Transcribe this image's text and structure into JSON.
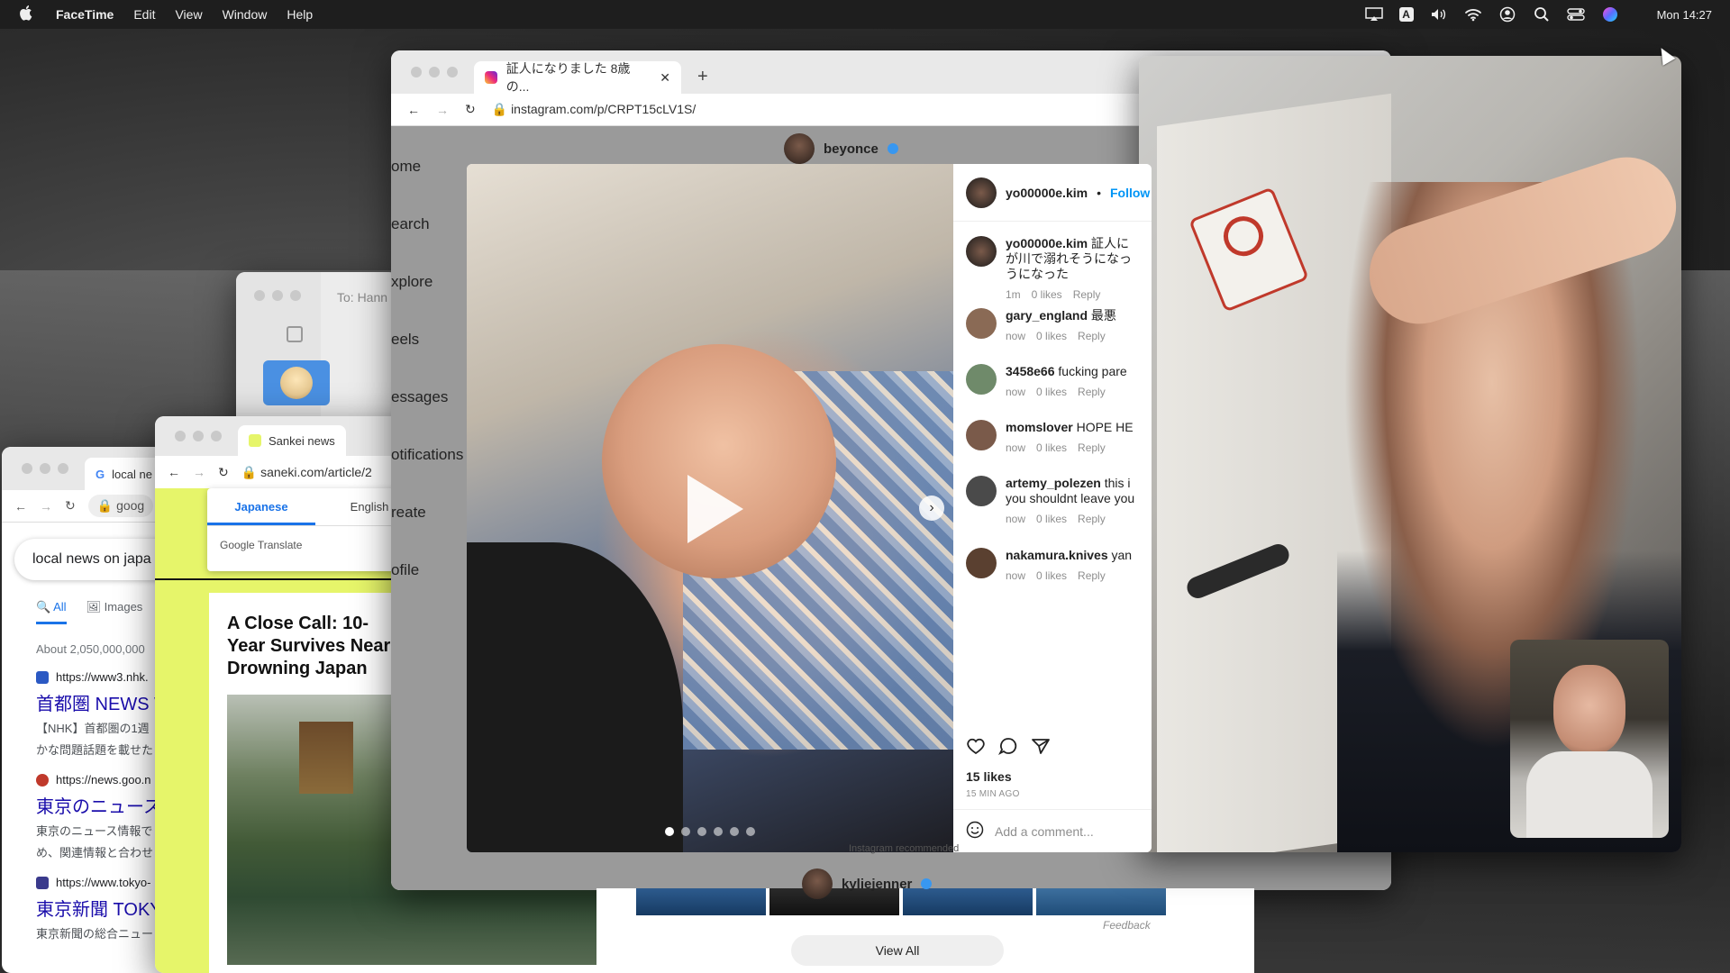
{
  "menubar": {
    "app": "FaceTime",
    "items": [
      "Edit",
      "View",
      "Window",
      "Help"
    ],
    "clock": "Mon 14:27",
    "icons": [
      "airplay-icon",
      "input-source-icon",
      "volume-icon",
      "wifi-icon",
      "user-icon",
      "spotlight-icon",
      "control-center-icon",
      "siri-icon"
    ],
    "input_source": "A"
  },
  "google": {
    "tab": "local ne",
    "address": "goog",
    "search_query": "local news on japa",
    "tabs": [
      "All",
      "Images"
    ],
    "count": "About 2,050,000,000",
    "results": [
      {
        "url": "https://www3.nhk.",
        "title": "首都圏 NEWS W",
        "snippet1": "【NHK】首都圏の1週",
        "snippet2": "かな問題話題を載せた",
        "fav_color": "#2b59c3"
      },
      {
        "url": "https://news.goo.n",
        "title": "東京のニュース",
        "snippet1": "東京のニュース情報で",
        "snippet2": "め、関連情報と合わせ",
        "fav_color": "#c0392b"
      },
      {
        "url": "https://www.tokyo-",
        "title": "東京新聞 TOKY",
        "snippet1": "東京新聞の総合ニュー",
        "snippet2": "",
        "fav_color": "#3a3a8c"
      }
    ]
  },
  "mail": {
    "to": "To: Hann"
  },
  "sankei": {
    "tab": "Sankei news",
    "address": "saneki.com/article/2",
    "translate": {
      "japanese": "Japanese",
      "english": "English",
      "brand": "Google Translate"
    },
    "headline": "A Close Call: 10-Year Survives Near-Drowning Japan"
  },
  "instagram": {
    "tab": "証人になりました 8歳の...",
    "address": "instagram.com/p/CRPT15cLV1S/",
    "nav": [
      "ome",
      "earch",
      "xplore",
      "eels",
      "essages",
      "otifications",
      "reate",
      "ofile"
    ],
    "feed_top_user": "beyonce",
    "post": {
      "user": "yo00000e.kim",
      "follow": "Follow",
      "caption_user": "yo00000e.kim",
      "caption_lines": [
        "証人に",
        "が川で溺れそうになっ",
        "うになった"
      ],
      "caption_meta": [
        "1m",
        "0 likes",
        "Reply"
      ],
      "comments": [
        {
          "user": "gary_england",
          "text": "最悪",
          "time": "now",
          "likes": "0 likes",
          "reply": "Reply",
          "avatar": "#8a6a55"
        },
        {
          "user": "3458e66",
          "text": "fucking pare",
          "time": "now",
          "likes": "0 likes",
          "reply": "Reply",
          "avatar": "#6f8a6a"
        },
        {
          "user": "momslover",
          "text": "HOPE HE",
          "time": "now",
          "likes": "0 likes",
          "reply": "Reply",
          "avatar": "#7a5a4a"
        },
        {
          "user": "artemy_polezen",
          "text": "this i",
          "text2": "you shouldnt leave you",
          "time": "now",
          "likes": "0 likes",
          "reply": "Reply",
          "avatar": "#4a4a4a"
        },
        {
          "user": "nakamura.knives",
          "text": "yan",
          "time": "now",
          "likes": "0 likes",
          "reply": "Reply",
          "avatar": "#5a4030"
        }
      ],
      "likes": "15 likes",
      "ago": "15 MIN AGO",
      "add_comment_placeholder": "Add a comment...",
      "carousel_count": 6,
      "carousel_active": 0
    },
    "recommended": "Instagram recommended",
    "next_user": "kyliejenner",
    "feedback": "Feedback",
    "view_all": "View All"
  }
}
